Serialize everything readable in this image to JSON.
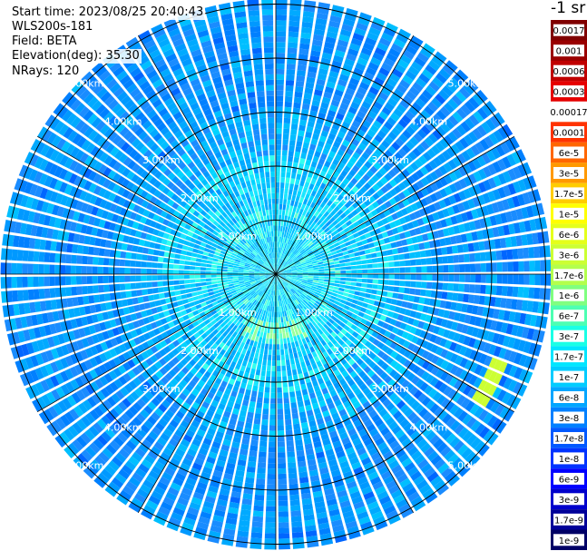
{
  "info": {
    "start_time": "Start time: 2023/08/25 20:40:43",
    "instrument": "WLS200s-181",
    "field": "Field: BETA",
    "elevation": "Elevation(deg): 35.30",
    "nrays": "NRays: 120"
  },
  "colorbar": {
    "unit": "-1 sr",
    "segments": [
      {
        "label": "0.0017",
        "color": "#800000"
      },
      {
        "label": "0.001",
        "color": "#9a0000"
      },
      {
        "label": "0.0006",
        "color": "#c00000"
      },
      {
        "label": "0.0003",
        "color": "#e60000"
      },
      {
        "label": "0.00017",
        "color": "#ffffff"
      },
      {
        "label": "0.0001",
        "color": "#ff3300"
      },
      {
        "label": "6e-5",
        "color": "#ff6600"
      },
      {
        "label": "3e-5",
        "color": "#ff9900"
      },
      {
        "label": "1.7e-5",
        "color": "#ffcc00"
      },
      {
        "label": "1e-5",
        "color": "#ffff00"
      },
      {
        "label": "6e-6",
        "color": "#e5ff1a"
      },
      {
        "label": "3e-6",
        "color": "#ccff33"
      },
      {
        "label": "1.7e-6",
        "color": "#b3ff4d"
      },
      {
        "label": "1e-6",
        "color": "#80ff80"
      },
      {
        "label": "6e-7",
        "color": "#4dffb3"
      },
      {
        "label": "3e-7",
        "color": "#1affe6"
      },
      {
        "label": "1.7e-7",
        "color": "#00e6ff"
      },
      {
        "label": "1e-7",
        "color": "#00ccff"
      },
      {
        "label": "6e-8",
        "color": "#00a6ff"
      },
      {
        "label": "3e-8",
        "color": "#0080ff"
      },
      {
        "label": "1.7e-8",
        "color": "#0059ff"
      },
      {
        "label": "1e-8",
        "color": "#0033ff"
      },
      {
        "label": "6e-9",
        "color": "#0000ff"
      },
      {
        "label": "3e-9",
        "color": "#0000cc"
      },
      {
        "label": "1.7e-9",
        "color": "#000099"
      },
      {
        "label": "1e-9",
        "color": "#000066"
      }
    ]
  },
  "chart_data": {
    "type": "heatmap",
    "projection": "polar PPI scan",
    "field": "BETA",
    "range_rings_km": [
      1,
      2,
      3,
      4,
      5
    ],
    "ring_labels": [
      "1.00km",
      "2.00km",
      "3.00km",
      "4.00km",
      "5.00km"
    ],
    "azimuth_lines_deg": [
      0,
      30,
      60,
      90,
      120,
      150,
      180,
      210,
      240,
      270,
      300,
      330
    ],
    "nrays": 120,
    "max_range_km": 5.1,
    "scale": "log",
    "value_pattern": "values near 1e-7 to 1e-6 within ~2 km (cyan/green); mostly 3e-8 to 1e-7 beyond (blue); a few 3e-6 gates around 4.3-4.6 km at azimuth ~110-120 deg"
  }
}
